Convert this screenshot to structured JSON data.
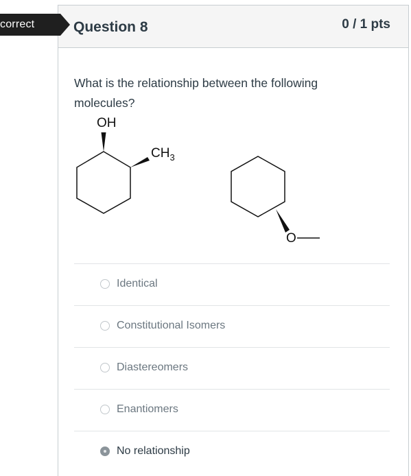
{
  "banner": {
    "label": "correct"
  },
  "question": {
    "title": "Question 8",
    "points": "0 / 1 pts",
    "text": "What is the relationship between the following molecules?"
  },
  "molecule_left": {
    "oh_label": "OH",
    "ch3_label": "CH",
    "ch3_subscript": "3"
  },
  "molecule_right": {
    "o_label": "O"
  },
  "answers": [
    {
      "label": "Identical",
      "selected": false
    },
    {
      "label": "Constitutional Isomers",
      "selected": false
    },
    {
      "label": "Diastereomers",
      "selected": false
    },
    {
      "label": "Enantiomers",
      "selected": false
    },
    {
      "label": "No relationship",
      "selected": true
    }
  ]
}
